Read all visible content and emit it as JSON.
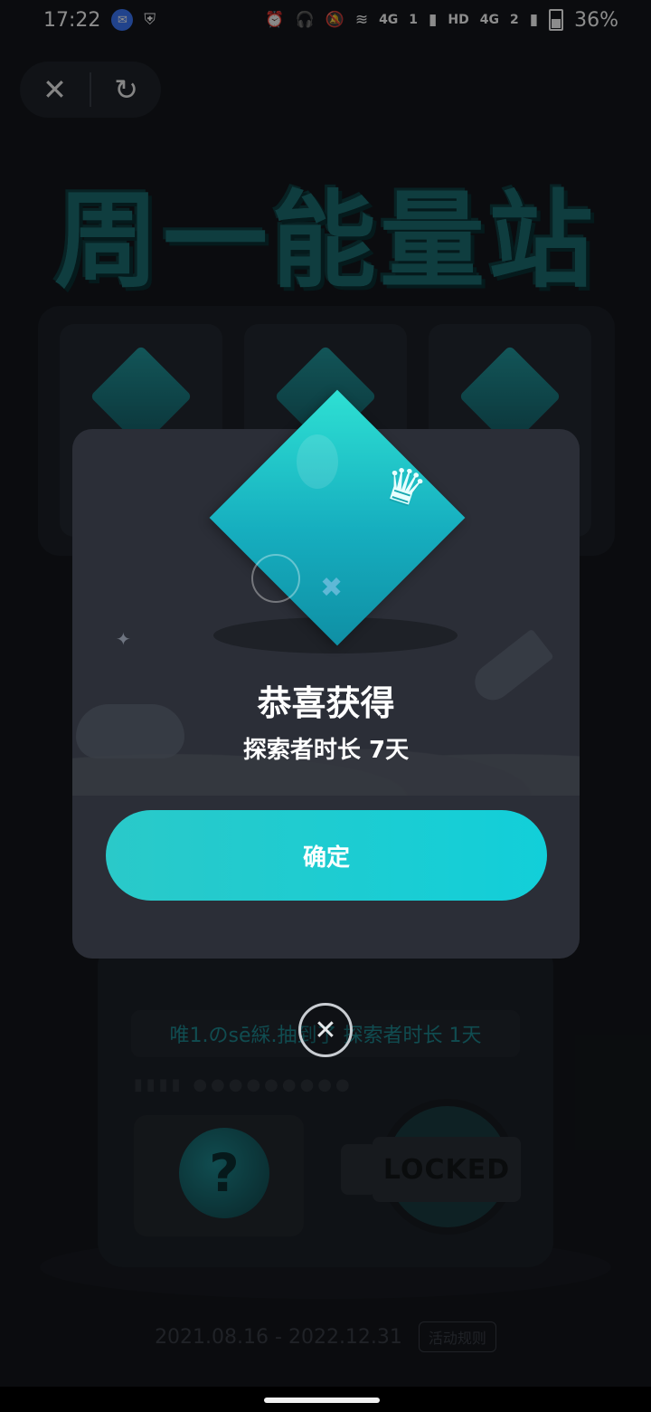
{
  "status_bar": {
    "time": "17:22",
    "network_1": "4G",
    "sim_1": "1",
    "hd": "HD",
    "network_2": "4G",
    "sim_2": "2",
    "battery": "36%"
  },
  "toolbar": {
    "close_glyph": "✕",
    "refresh_glyph": "↻"
  },
  "page": {
    "title": "周一能量站",
    "ticker_text": "唯1.のsē綵.抽到了 探索者时长 1天",
    "locked_label": "LOCKED",
    "mystery_glyph": "?",
    "date_range": "2021.08.16 - 2022.12.31",
    "rules_label": "活动规则"
  },
  "modal": {
    "title": "恭喜获得",
    "subtitle": "探索者时长 7天",
    "confirm_label": "确定",
    "close_glyph": "✕"
  },
  "colors": {
    "accent": "#12cfd9",
    "modal_bg": "#2b2e37",
    "page_bg": "#14171c"
  }
}
